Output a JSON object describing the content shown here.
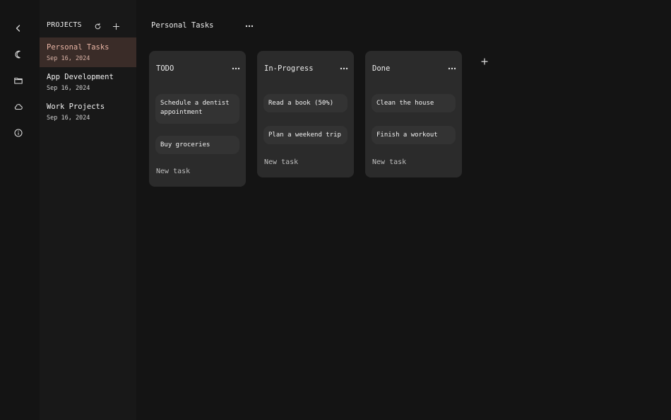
{
  "rail": {
    "items": [
      {
        "icon": "chevron-left-icon"
      },
      {
        "icon": "moon-icon"
      },
      {
        "icon": "folder-icon"
      },
      {
        "icon": "cloud-icon"
      },
      {
        "icon": "info-icon"
      }
    ]
  },
  "projects": {
    "title": "PROJECTS",
    "items": [
      {
        "name": "Personal Tasks",
        "date": "Sep 16, 2024",
        "active": true
      },
      {
        "name": "App Development",
        "date": "Sep 16, 2024",
        "active": false
      },
      {
        "name": "Work Projects",
        "date": "Sep 16, 2024",
        "active": false
      }
    ]
  },
  "board": {
    "title": "Personal Tasks",
    "columns": [
      {
        "title": "TODO",
        "tasks": [
          "Schedule a dentist appointment",
          "Buy groceries"
        ],
        "new_task_label": "New task"
      },
      {
        "title": "In-Progress",
        "tasks": [
          "Read a book (50%)",
          "Plan a weekend trip"
        ],
        "new_task_label": "New task"
      },
      {
        "title": "Done",
        "tasks": [
          "Clean the house",
          "Finish a workout"
        ],
        "new_task_label": "New task"
      }
    ]
  },
  "colors": {
    "background": "#141414",
    "panel": "#181818",
    "column": "#2b2b2b",
    "task": "#333333",
    "active_project_bg": "#3a2c28",
    "active_project_text": "#e8b4a4"
  }
}
